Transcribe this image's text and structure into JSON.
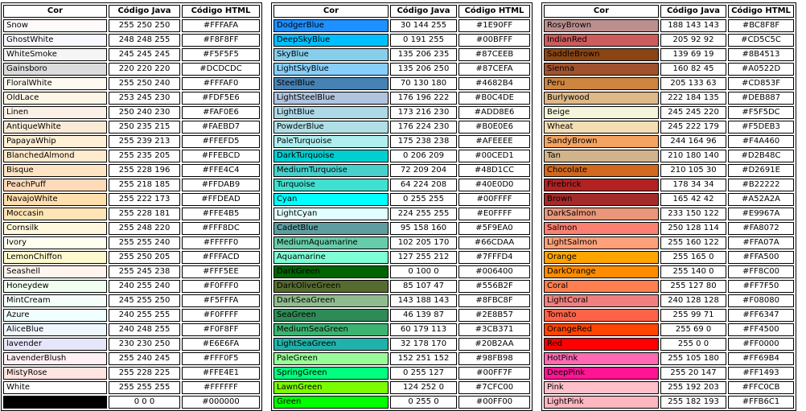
{
  "headers": {
    "name": "Cor",
    "java": "Código Java",
    "html": "Código HTML"
  },
  "tables": [
    {
      "rows": [
        {
          "name": "Snow",
          "java": "255 250 250",
          "html": "#FFFAFA",
          "color": "#FFFAFA",
          "text": "#000000"
        },
        {
          "name": "GhostWhite",
          "java": "248 248 255",
          "html": "#F8F8FF",
          "color": "#F8F8FF",
          "text": "#000000"
        },
        {
          "name": "WhiteSmoke",
          "java": "245 245 245",
          "html": "#F5F5F5",
          "color": "#F5F5F5",
          "text": "#000000"
        },
        {
          "name": "Gainsboro",
          "java": "220 220 220",
          "html": "#DCDCDC",
          "color": "#DCDCDC",
          "text": "#000000"
        },
        {
          "name": "FloralWhite",
          "java": "255 250 240",
          "html": "#FFFAF0",
          "color": "#FFFAF0",
          "text": "#000000"
        },
        {
          "name": "OldLace",
          "java": "253 245 230",
          "html": "#FDF5E6",
          "color": "#FDF5E6",
          "text": "#000000"
        },
        {
          "name": "Linen",
          "java": "250 240 230",
          "html": "#FAF0E6",
          "color": "#FAF0E6",
          "text": "#000000"
        },
        {
          "name": "AntiqueWhite",
          "java": "250 235 215",
          "html": "#FAEBD7",
          "color": "#FAEBD7",
          "text": "#000000"
        },
        {
          "name": "PapayaWhip",
          "java": "255 239 213",
          "html": "#FFEFD5",
          "color": "#FFEFD5",
          "text": "#000000"
        },
        {
          "name": "BlanchedAlmond",
          "java": "255 235 205",
          "html": "#FFEBCD",
          "color": "#FFEBCD",
          "text": "#000000"
        },
        {
          "name": "Bisque",
          "java": "255 228 196",
          "html": "#FFE4C4",
          "color": "#FFE4C4",
          "text": "#000000"
        },
        {
          "name": "PeachPuff",
          "java": "255 218 185",
          "html": "#FFDAB9",
          "color": "#FFDAB9",
          "text": "#000000"
        },
        {
          "name": "NavajoWhite",
          "java": "255 222 173",
          "html": "#FFDEAD",
          "color": "#FFDEAD",
          "text": "#000000"
        },
        {
          "name": "Moccasin",
          "java": "255 228 181",
          "html": "#FFE4B5",
          "color": "#FFE4B5",
          "text": "#000000"
        },
        {
          "name": "Cornsilk",
          "java": "255 248 220",
          "html": "#FFF8DC",
          "color": "#FFF8DC",
          "text": "#000000"
        },
        {
          "name": "Ivory",
          "java": "255 255 240",
          "html": "#FFFFF0",
          "color": "#FFFFF0",
          "text": "#000000"
        },
        {
          "name": "LemonChiffon",
          "java": "255 250 205",
          "html": "#FFFACD",
          "color": "#FFFACD",
          "text": "#000000"
        },
        {
          "name": "Seashell",
          "java": "255 245 238",
          "html": "#FFF5EE",
          "color": "#FFF5EE",
          "text": "#000000"
        },
        {
          "name": "Honeydew",
          "java": "240 255 240",
          "html": "#F0FFF0",
          "color": "#F0FFF0",
          "text": "#000000"
        },
        {
          "name": "MintCream",
          "java": "245 255 250",
          "html": "#F5FFFA",
          "color": "#F5FFFA",
          "text": "#000000"
        },
        {
          "name": "Azure",
          "java": "240 255 255",
          "html": "#F0FFFF",
          "color": "#F0FFFF",
          "text": "#000000"
        },
        {
          "name": "AliceBlue",
          "java": "240 248 255",
          "html": "#F0F8FF",
          "color": "#F0F8FF",
          "text": "#000000"
        },
        {
          "name": "lavender",
          "java": "230 230 250",
          "html": "#E6E6FA",
          "color": "#E6E6FA",
          "text": "#000000"
        },
        {
          "name": "LavenderBlush",
          "java": "255 240 245",
          "html": "#FFF0F5",
          "color": "#FFF0F5",
          "text": "#000000"
        },
        {
          "name": "MistyRose",
          "java": "255 228 225",
          "html": "#FFE4E1",
          "color": "#FFE4E1",
          "text": "#000000"
        },
        {
          "name": "White",
          "java": "255 255 255",
          "html": "#FFFFFF",
          "color": "#FFFFFF",
          "text": "#000000"
        },
        {
          "name": "",
          "java": "0 0 0",
          "html": "#000000",
          "color": "#000000",
          "text": "#FFFFFF"
        }
      ]
    },
    {
      "rows": [
        {
          "name": "DodgerBlue",
          "java": "30 144 255",
          "html": "#1E90FF",
          "color": "#1E90FF",
          "text": "#000000"
        },
        {
          "name": "DeepSkyBlue",
          "java": "0 191 255",
          "html": "#00BFFF",
          "color": "#00BFFF",
          "text": "#000000"
        },
        {
          "name": "SkyBlue",
          "java": "135 206 235",
          "html": "#87CEEB",
          "color": "#87CEEB",
          "text": "#000000"
        },
        {
          "name": "LightSkyBlue",
          "java": "135 206 250",
          "html": "#87CEFA",
          "color": "#87CEFA",
          "text": "#000000"
        },
        {
          "name": "SteelBlue",
          "java": "70 130 180",
          "html": "#4682B4",
          "color": "#4682B4",
          "text": "#000000"
        },
        {
          "name": "LightSteelBlue",
          "java": "176 196 222",
          "html": "#B0C4DE",
          "color": "#B0C4DE",
          "text": "#000000"
        },
        {
          "name": "LightBlue",
          "java": "173 216 230",
          "html": "#ADD8E6",
          "color": "#ADD8E6",
          "text": "#000000"
        },
        {
          "name": "PowderBlue",
          "java": "176 224 230",
          "html": "#B0E0E6",
          "color": "#B0E0E6",
          "text": "#000000"
        },
        {
          "name": "PaleTurquoise",
          "java": "175 238 238",
          "html": "#AFEEEE",
          "color": "#AFEEEE",
          "text": "#000000"
        },
        {
          "name": "DarkTurquoise",
          "java": "0 206 209",
          "html": "#00CED1",
          "color": "#00CED1",
          "text": "#000000"
        },
        {
          "name": "MediumTurquoise",
          "java": "72 209 204",
          "html": "#48D1CC",
          "color": "#48D1CC",
          "text": "#000000"
        },
        {
          "name": "Turquoise",
          "java": "64 224 208",
          "html": "#40E0D0",
          "color": "#40E0D0",
          "text": "#000000"
        },
        {
          "name": "Cyan",
          "java": "0 255 255",
          "html": "#00FFFF",
          "color": "#00FFFF",
          "text": "#000000"
        },
        {
          "name": "LightCyan",
          "java": "224 255 255",
          "html": "#E0FFFF",
          "color": "#E0FFFF",
          "text": "#000000"
        },
        {
          "name": "CadetBlue",
          "java": "95 158 160",
          "html": "#5F9EA0",
          "color": "#5F9EA0",
          "text": "#000000"
        },
        {
          "name": "MediumAquamarine",
          "java": "102 205 170",
          "html": "#66CDAA",
          "color": "#66CDAA",
          "text": "#000000"
        },
        {
          "name": "Aquamarine",
          "java": "127 255 212",
          "html": "#7FFFD4",
          "color": "#7FFFD4",
          "text": "#000000"
        },
        {
          "name": "DarkGreen",
          "java": "0 100 0",
          "html": "#006400",
          "color": "#006400",
          "text": "#000000"
        },
        {
          "name": "DarkOliveGreen",
          "java": "85 107 47",
          "html": "#556B2F",
          "color": "#556B2F",
          "text": "#000000"
        },
        {
          "name": "DarkSeaGreen",
          "java": "143 188 143",
          "html": "#8FBC8F",
          "color": "#8FBC8F",
          "text": "#000000"
        },
        {
          "name": "SeaGreen",
          "java": "46 139 87",
          "html": "#2E8B57",
          "color": "#2E8B57",
          "text": "#000000"
        },
        {
          "name": "MediumSeaGreen",
          "java": "60 179 113",
          "html": "#3CB371",
          "color": "#3CB371",
          "text": "#000000"
        },
        {
          "name": "LightSeaGreen",
          "java": "32 178 170",
          "html": "#20B2AA",
          "color": "#20B2AA",
          "text": "#000000"
        },
        {
          "name": "PaleGreen",
          "java": "152 251 152",
          "html": "#98FB98",
          "color": "#98FB98",
          "text": "#000000"
        },
        {
          "name": "SpringGreen",
          "java": "0 255 127",
          "html": "#00FF7F",
          "color": "#00FF7F",
          "text": "#000000"
        },
        {
          "name": "LawnGreen",
          "java": "124 252 0",
          "html": "#7CFC00",
          "color": "#7CFC00",
          "text": "#000000"
        },
        {
          "name": "Green",
          "java": "0 255 0",
          "html": "#00FF00",
          "color": "#00FF00",
          "text": "#000000"
        }
      ]
    },
    {
      "rows": [
        {
          "name": "RosyBrown",
          "java": "188 143 143",
          "html": "#BC8F8F",
          "color": "#BC8F8F",
          "text": "#000000"
        },
        {
          "name": "IndianRed",
          "java": "205 92 92",
          "html": "#CD5C5C",
          "color": "#CD5C5C",
          "text": "#000000"
        },
        {
          "name": "SaddleBrown",
          "java": "139 69 19",
          "html": "#8B4513",
          "color": "#8B4513",
          "text": "#000000"
        },
        {
          "name": "Sienna",
          "java": "160 82 45",
          "html": "#A0522D",
          "color": "#A0522D",
          "text": "#000000"
        },
        {
          "name": "Peru",
          "java": "205 133 63",
          "html": "#CD853F",
          "color": "#CD853F",
          "text": "#000000"
        },
        {
          "name": "Burlywood",
          "java": "222 184 135",
          "html": "#DEB887",
          "color": "#DEB887",
          "text": "#000000"
        },
        {
          "name": "Beige",
          "java": "245 245 220",
          "html": "#F5F5DC",
          "color": "#F5F5DC",
          "text": "#000000"
        },
        {
          "name": "Wheat",
          "java": "245 222 179",
          "html": "#F5DEB3",
          "color": "#F5DEB3",
          "text": "#000000"
        },
        {
          "name": "SandyBrown",
          "java": "244 164 96",
          "html": "#F4A460",
          "color": "#F4A460",
          "text": "#000000"
        },
        {
          "name": "Tan",
          "java": "210 180 140",
          "html": "#D2B48C",
          "color": "#D2B48C",
          "text": "#000000"
        },
        {
          "name": "Chocolate",
          "java": "210 105 30",
          "html": "#D2691E",
          "color": "#D2691E",
          "text": "#000000"
        },
        {
          "name": "Firebrick",
          "java": "178 34 34",
          "html": "#B22222",
          "color": "#B22222",
          "text": "#000000"
        },
        {
          "name": "Brown",
          "java": "165 42 42",
          "html": "#A52A2A",
          "color": "#A52A2A",
          "text": "#000000"
        },
        {
          "name": "DarkSalmon",
          "java": "233 150 122",
          "html": "#E9967A",
          "color": "#E9967A",
          "text": "#000000"
        },
        {
          "name": "Salmon",
          "java": "250 128 114",
          "html": "#FA8072",
          "color": "#FA8072",
          "text": "#000000"
        },
        {
          "name": "LightSalmon",
          "java": "255 160 122",
          "html": "#FFA07A",
          "color": "#FFA07A",
          "text": "#000000"
        },
        {
          "name": "Orange",
          "java": "255 165 0",
          "html": "#FFA500",
          "color": "#FFA500",
          "text": "#000000"
        },
        {
          "name": "DarkOrange",
          "java": "255 140 0",
          "html": "#FF8C00",
          "color": "#FF8C00",
          "text": "#000000"
        },
        {
          "name": "Coral",
          "java": "255 127 80",
          "html": "#FF7F50",
          "color": "#FF7F50",
          "text": "#000000"
        },
        {
          "name": "LightCoral",
          "java": "240 128 128",
          "html": "#F08080",
          "color": "#F08080",
          "text": "#000000"
        },
        {
          "name": "Tomato",
          "java": "255 99 71",
          "html": "#FF6347",
          "color": "#FF6347",
          "text": "#000000"
        },
        {
          "name": "OrangeRed",
          "java": "255 69 0",
          "html": "#FF4500",
          "color": "#FF4500",
          "text": "#000000"
        },
        {
          "name": "Red",
          "java": "255 0 0",
          "html": "#FF0000",
          "color": "#FF0000",
          "text": "#000000"
        },
        {
          "name": "HotPink",
          "java": "255 105 180",
          "html": "#FF69B4",
          "color": "#FF69B4",
          "text": "#000000"
        },
        {
          "name": "DeepPink",
          "java": "255 20 147",
          "html": "#FF1493",
          "color": "#FF1493",
          "text": "#000000"
        },
        {
          "name": "Pink",
          "java": "255 192 203",
          "html": "#FFC0CB",
          "color": "#FFC0CB",
          "text": "#000000"
        },
        {
          "name": "LightPink",
          "java": "255 182 193",
          "html": "#FFB6C1",
          "color": "#FFB6C1",
          "text": "#000000"
        }
      ]
    }
  ]
}
